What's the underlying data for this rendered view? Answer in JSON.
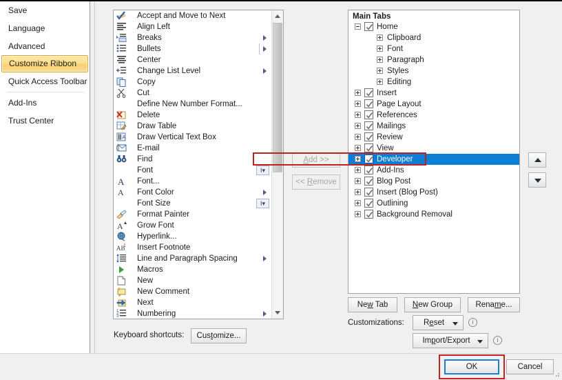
{
  "sidebar": {
    "items": [
      {
        "label": "Save",
        "selected": false,
        "sep_after": false
      },
      {
        "label": "Language",
        "selected": false,
        "sep_after": false
      },
      {
        "label": "Advanced",
        "selected": false,
        "sep_after": false
      },
      {
        "label": "Customize Ribbon",
        "selected": true,
        "sep_after": false
      },
      {
        "label": "Quick Access Toolbar",
        "selected": false,
        "sep_after": true
      },
      {
        "label": "Add-Ins",
        "selected": false,
        "sep_after": false
      },
      {
        "label": "Trust Center",
        "selected": false,
        "sep_after": false
      }
    ]
  },
  "commands": {
    "items": [
      {
        "label": "Accept and Move to Next",
        "icon": "accept-check-icon",
        "arrow": false,
        "combo": false
      },
      {
        "label": "Align Left",
        "icon": "align-left-icon",
        "arrow": false,
        "combo": false
      },
      {
        "label": "Breaks",
        "icon": "breaks-icon",
        "arrow": true,
        "combo": false
      },
      {
        "label": "Bullets",
        "icon": "bullets-icon",
        "arrow": true,
        "combo": false,
        "sep": true
      },
      {
        "label": "Center",
        "icon": "align-center-icon",
        "arrow": false,
        "combo": false
      },
      {
        "label": "Change List Level",
        "icon": "change-list-level-icon",
        "arrow": true,
        "combo": false
      },
      {
        "label": "Copy",
        "icon": "copy-icon",
        "arrow": false,
        "combo": false
      },
      {
        "label": "Cut",
        "icon": "scissors-icon",
        "arrow": false,
        "combo": false
      },
      {
        "label": "Define New Number Format...",
        "icon": "none",
        "arrow": false,
        "combo": false
      },
      {
        "label": "Delete",
        "icon": "delete-icon",
        "arrow": false,
        "combo": false
      },
      {
        "label": "Draw Table",
        "icon": "draw-table-icon",
        "arrow": false,
        "combo": false
      },
      {
        "label": "Draw Vertical Text Box",
        "icon": "vertical-textbox-icon",
        "arrow": false,
        "combo": false
      },
      {
        "label": "E-mail",
        "icon": "email-icon",
        "arrow": false,
        "combo": false
      },
      {
        "label": "Find",
        "icon": "binoculars-icon",
        "arrow": false,
        "combo": false
      },
      {
        "label": "Font",
        "icon": "none",
        "arrow": false,
        "combo": true
      },
      {
        "label": "Font...",
        "icon": "font-a-icon",
        "arrow": false,
        "combo": false
      },
      {
        "label": "Font Color",
        "icon": "font-color-icon",
        "arrow": true,
        "combo": false
      },
      {
        "label": "Font Size",
        "icon": "none",
        "arrow": false,
        "combo": true
      },
      {
        "label": "Format Painter",
        "icon": "paintbrush-icon",
        "arrow": false,
        "combo": false
      },
      {
        "label": "Grow Font",
        "icon": "grow-font-icon",
        "arrow": false,
        "combo": false
      },
      {
        "label": "Hyperlink...",
        "icon": "globe-link-icon",
        "arrow": false,
        "combo": false
      },
      {
        "label": "Insert Footnote",
        "icon": "footnote-icon",
        "arrow": false,
        "combo": false
      },
      {
        "label": "Line and Paragraph Spacing",
        "icon": "line-spacing-icon",
        "arrow": true,
        "combo": false
      },
      {
        "label": "Macros",
        "icon": "play-green-icon",
        "arrow": false,
        "combo": false
      },
      {
        "label": "New",
        "icon": "new-doc-icon",
        "arrow": false,
        "combo": false
      },
      {
        "label": "New Comment",
        "icon": "new-comment-icon",
        "arrow": false,
        "combo": false
      },
      {
        "label": "Next",
        "icon": "next-arrow-icon",
        "arrow": false,
        "combo": false
      },
      {
        "label": "Numbering",
        "icon": "numbering-icon",
        "arrow": true,
        "combo": false
      }
    ]
  },
  "transfer": {
    "add_label_before": "A",
    "add_label_accel": "A",
    "add_label": "Add >>",
    "remove_label": "<< Remove"
  },
  "tree": {
    "header": "Main Tabs",
    "rows": [
      {
        "label": "Home",
        "level": 1,
        "expander": "minus",
        "checked": true,
        "selected": false
      },
      {
        "label": "Clipboard",
        "level": 2,
        "expander": "plus",
        "checked": null,
        "selected": false
      },
      {
        "label": "Font",
        "level": 2,
        "expander": "plus",
        "checked": null,
        "selected": false
      },
      {
        "label": "Paragraph",
        "level": 2,
        "expander": "plus",
        "checked": null,
        "selected": false
      },
      {
        "label": "Styles",
        "level": 2,
        "expander": "plus",
        "checked": null,
        "selected": false
      },
      {
        "label": "Editing",
        "level": 2,
        "expander": "plus",
        "checked": null,
        "selected": false
      },
      {
        "label": "Insert",
        "level": 1,
        "expander": "plus",
        "checked": true,
        "selected": false
      },
      {
        "label": "Page Layout",
        "level": 1,
        "expander": "plus",
        "checked": true,
        "selected": false
      },
      {
        "label": "References",
        "level": 1,
        "expander": "plus",
        "checked": true,
        "selected": false
      },
      {
        "label": "Mailings",
        "level": 1,
        "expander": "plus",
        "checked": true,
        "selected": false
      },
      {
        "label": "Review",
        "level": 1,
        "expander": "plus",
        "checked": true,
        "selected": false
      },
      {
        "label": "View",
        "level": 1,
        "expander": "plus",
        "checked": true,
        "selected": false
      },
      {
        "label": "Developer",
        "level": 1,
        "expander": "plus",
        "checked": true,
        "selected": true
      },
      {
        "label": "Add-Ins",
        "level": 1,
        "expander": "plus",
        "checked": true,
        "selected": false
      },
      {
        "label": "Blog Post",
        "level": 1,
        "expander": "plus",
        "checked": true,
        "selected": false
      },
      {
        "label": "Insert (Blog Post)",
        "level": 1,
        "expander": "plus",
        "checked": true,
        "selected": false
      },
      {
        "label": "Outlining",
        "level": 1,
        "expander": "plus",
        "checked": true,
        "selected": false
      },
      {
        "label": "Background Removal",
        "level": 1,
        "expander": "plus",
        "checked": true,
        "selected": false
      }
    ]
  },
  "buttons": {
    "new_tab": {
      "pre": "Ne",
      "accel": "w",
      "post": " Tab"
    },
    "new_group": {
      "pre": "",
      "accel": "N",
      "post": "ew Group"
    },
    "rename": {
      "pre": "Rena",
      "accel": "m",
      "post": "e..."
    },
    "customize": {
      "pre": "Cus",
      "accel": "t",
      "post": "omize..."
    },
    "reset": {
      "pre": "R",
      "accel": "e",
      "post": "set"
    },
    "import_export": {
      "pre": "Im",
      "accel": "p",
      "post": "ort/Export"
    },
    "add": {
      "pre": "",
      "accel": "A",
      "post": "dd >>"
    },
    "remove": {
      "pre": "<< ",
      "accel": "R",
      "post": "emove"
    },
    "ok": "OK",
    "cancel": "Cancel",
    "order_up": "move-up",
    "order_down": "move-down"
  },
  "labels": {
    "keyboard_shortcuts": "Keyboard shortcuts:",
    "customizations": "Customizations:",
    "info_glyph": "i"
  },
  "colors": {
    "selection_blue": "#0c7fd4",
    "annotation_red": "#c0201f",
    "sidebar_highlight": "#f8d271",
    "focus_blue": "#1a7fd4"
  }
}
